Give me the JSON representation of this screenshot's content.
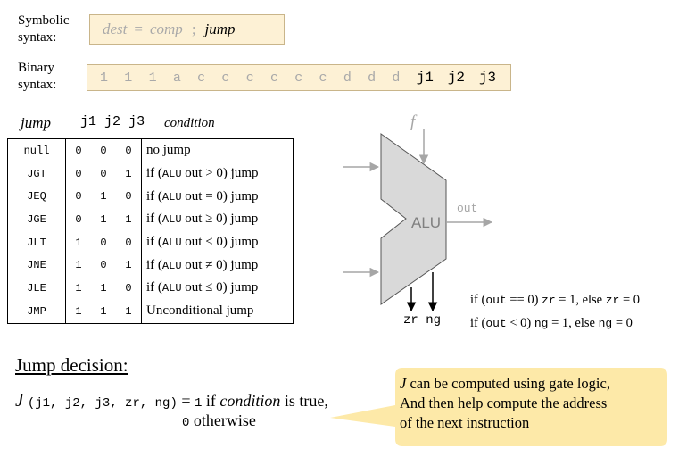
{
  "symbolic": {
    "label_line1": "Symbolic",
    "label_line2": "syntax:",
    "dest": "dest",
    "eq": "=",
    "comp": "comp",
    "semi": ";",
    "jump": "jump"
  },
  "binary": {
    "label_line1": "Binary",
    "label_line2": "syntax:",
    "bits": [
      "1",
      "1",
      "1",
      "a",
      "c",
      "c",
      "c",
      "c",
      "c",
      "c",
      "d",
      "d",
      "d"
    ],
    "jump_bits": [
      "j1",
      "j2",
      "j3"
    ]
  },
  "table_header": {
    "jump": "jump",
    "j1": "j1",
    "j2": "j2",
    "j3": "j3",
    "condition": "condition"
  },
  "jump_table": [
    {
      "mnemonic": "null",
      "j1": "0",
      "j2": "0",
      "j3": "0",
      "pre": "no jump",
      "alu": "",
      "post": ""
    },
    {
      "mnemonic": "JGT",
      "j1": "0",
      "j2": "0",
      "j3": "1",
      "pre": "if (",
      "alu": "ALU",
      "post": " out > 0) jump"
    },
    {
      "mnemonic": "JEQ",
      "j1": "0",
      "j2": "1",
      "j3": "0",
      "pre": "if (",
      "alu": "ALU",
      "post": " out = 0) jump"
    },
    {
      "mnemonic": "JGE",
      "j1": "0",
      "j2": "1",
      "j3": "1",
      "pre": "if (",
      "alu": "ALU",
      "post": " out ≥ 0) jump"
    },
    {
      "mnemonic": "JLT",
      "j1": "1",
      "j2": "0",
      "j3": "0",
      "pre": "if (",
      "alu": "ALU",
      "post": " out < 0) jump"
    },
    {
      "mnemonic": "JNE",
      "j1": "1",
      "j2": "0",
      "j3": "1",
      "pre": "if (",
      "alu": "ALU",
      "post": " out ≠ 0) jump"
    },
    {
      "mnemonic": "JLE",
      "j1": "1",
      "j2": "1",
      "j3": "0",
      "pre": "if (",
      "alu": "ALU",
      "post": " out ≤ 0) jump"
    },
    {
      "mnemonic": "JMP",
      "j1": "1",
      "j2": "1",
      "j3": "1",
      "pre": "Unconditional jump",
      "alu": "",
      "post": ""
    }
  ],
  "alu": {
    "label": "ALU",
    "f": "f",
    "out": "out",
    "zr_ng": "zr ng"
  },
  "flags": {
    "zr_line": [
      "if (",
      "out",
      " == 0) ",
      "zr",
      " = 1, else ",
      "zr",
      " = 0"
    ],
    "ng_line": [
      "if (",
      "out",
      " < 0)  ",
      "ng",
      " = 1, else ",
      "ng",
      " = 0"
    ]
  },
  "decision": {
    "title": "Jump decision:",
    "J": "J",
    "args": "(j1, j2, j3, zr, ng)",
    "eq_one": " = ",
    "one": "1",
    "if_text": " if ",
    "condition": "condition",
    "true_text": " is true,",
    "zero": "0",
    "otherwise": " otherwise"
  },
  "callout": {
    "J": "J",
    "line1_rest": " can be computed using gate logic,",
    "line2": "And then help compute the address",
    "line3": "of the next instruction"
  },
  "colors": {
    "box_fill": "#fdf1d5",
    "box_border": "#c9b58a",
    "alu_fill": "#d9d9d9",
    "gray_text": "#a9a9a9",
    "arrow_gray": "#a6a6a6",
    "callout_fill": "#fde9a8"
  }
}
